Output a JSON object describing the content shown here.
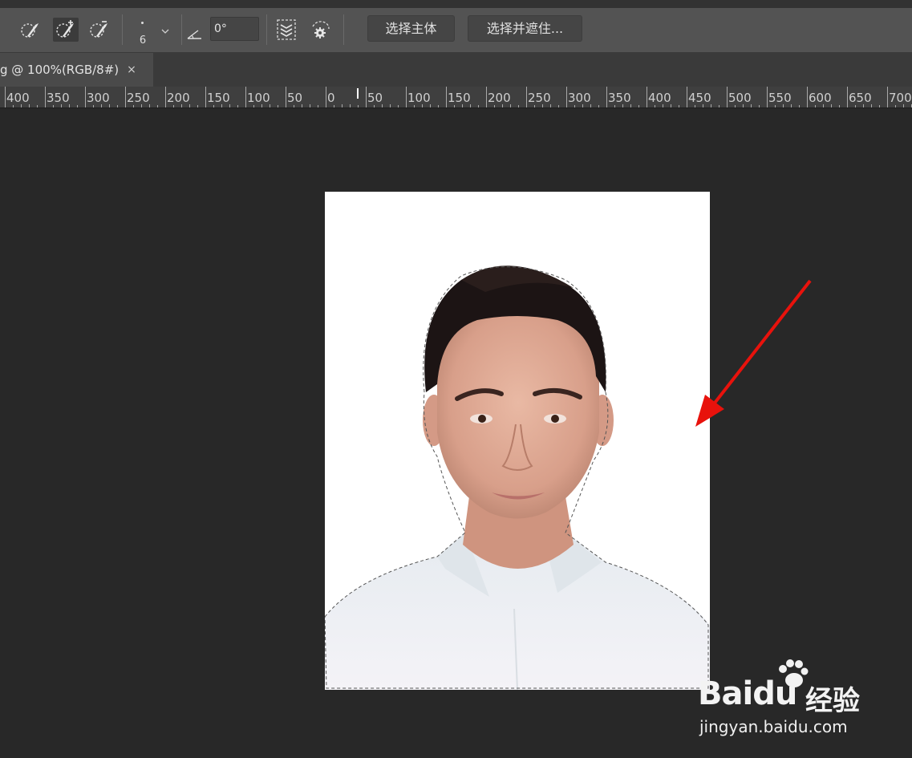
{
  "options_bar": {
    "tools": [
      {
        "name": "new-selection-brush-icon",
        "active": false
      },
      {
        "name": "add-to-selection-brush-icon",
        "active": true
      },
      {
        "name": "subtract-from-selection-brush-icon",
        "active": false
      }
    ],
    "brush_size": "6",
    "angle_value": "0°",
    "select_subject_label": "选择主体",
    "select_and_mask_label": "选择并遮住..."
  },
  "document_tab": {
    "title": "g @ 100%(RGB/8#)",
    "close_glyph": "×"
  },
  "ruler": {
    "labels": [
      "400",
      "350",
      "300",
      "250",
      "200",
      "150",
      "100",
      "50",
      "0",
      "50",
      "100",
      "150",
      "200",
      "250",
      "300",
      "350",
      "400",
      "450",
      "500",
      "550",
      "600",
      "650",
      "700"
    ]
  },
  "watermark": {
    "logo_text_left": "Bai",
    "logo_text_right": "du",
    "suffix": "经验",
    "url": "jingyan.baidu.com"
  },
  "colors": {
    "workspace_bg": "#282828",
    "options_bar_bg": "#535353",
    "annotation_arrow": "#e8120c"
  }
}
